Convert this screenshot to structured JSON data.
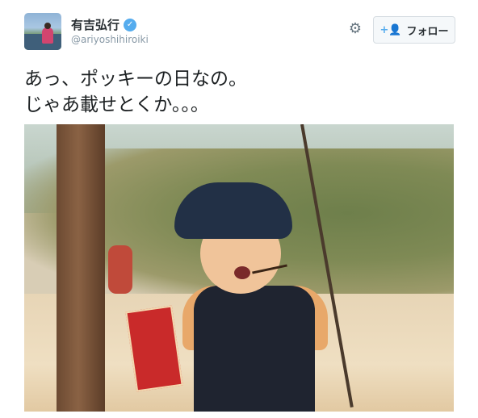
{
  "tweet": {
    "author": {
      "display_name": "有吉弘行",
      "handle": "@ariyoshihiroiki",
      "verified": true
    },
    "actions": {
      "follow_label": "フォロー",
      "settings_icon": "gear-icon",
      "follow_icon": "add-user-icon"
    },
    "text_lines": [
      "あっ、ポッキーの日なの。",
      "じゃあ載せとくか。。。"
    ]
  },
  "colors": {
    "verified_blue": "#55acee",
    "text_primary": "#292f33",
    "text_secondary": "#8899a6",
    "button_border": "#d7dde2"
  }
}
